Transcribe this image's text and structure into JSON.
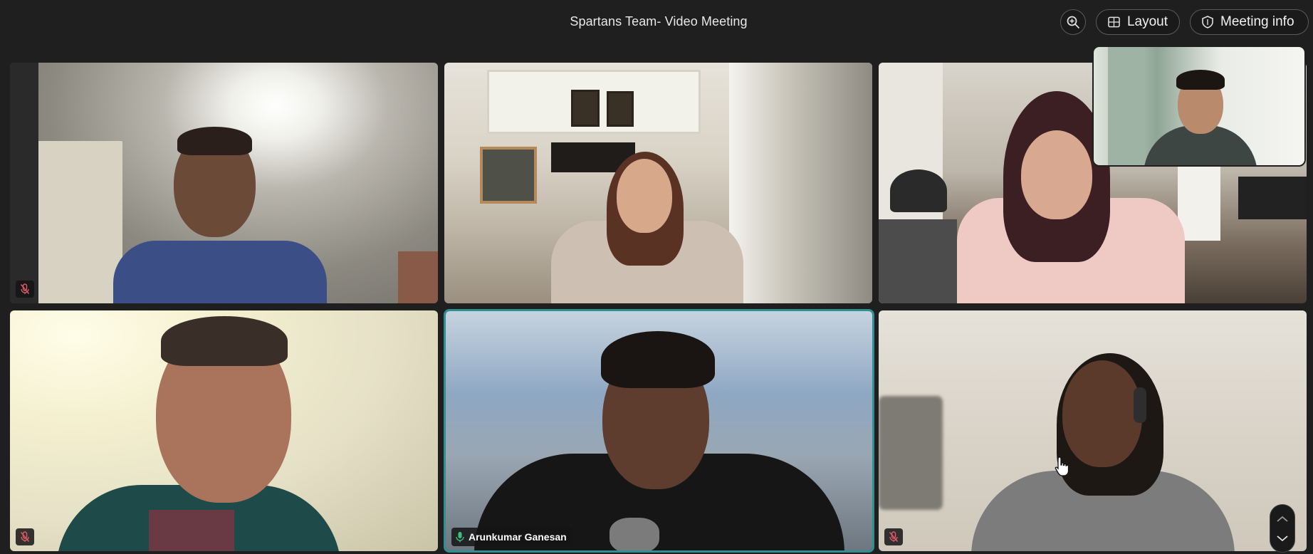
{
  "meeting": {
    "title": "Spartans Team- Video Meeting"
  },
  "toolbar": {
    "zoom_icon": "zoom-in-icon",
    "layout_label": "Layout",
    "layout_icon": "grid-icon",
    "info_label": "Meeting info",
    "info_icon": "shield-icon"
  },
  "participants": [
    {
      "tile": 1,
      "muted": true,
      "name_shown": false
    },
    {
      "tile": 2,
      "muted": false,
      "name_shown": false
    },
    {
      "tile": 3,
      "muted": false,
      "name_shown": false
    },
    {
      "tile": 4,
      "muted": true,
      "name_shown": false
    },
    {
      "tile": 5,
      "muted": false,
      "name_shown": true,
      "name": "Arunkumar Ganesan",
      "speaking": true
    },
    {
      "tile": 6,
      "muted": true,
      "name_shown": false
    }
  ],
  "colors": {
    "background": "#1f1f1f",
    "active_speaker_border": "#2f8f92",
    "mic_active": "#3fbf7f",
    "mic_muted": "#e05a6a"
  }
}
